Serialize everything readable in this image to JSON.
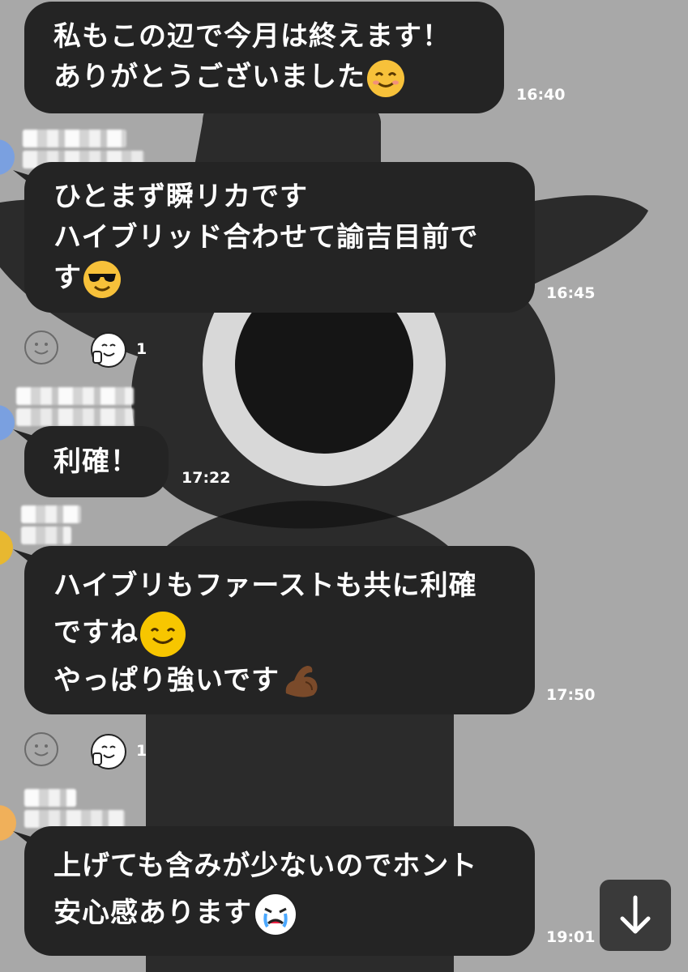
{
  "messages": [
    {
      "lines": [
        "私もこの辺で今月は終えます！",
        "ありがとうございました"
      ],
      "time": "16:40"
    },
    {
      "lines": [
        "ひとまず瞬リカです",
        "ハイブリッド合わせて諭吉目前で",
        "す"
      ],
      "time": "16:45",
      "reaction_count": "1"
    },
    {
      "lines": [
        "利確！"
      ],
      "time": "17:22"
    },
    {
      "lines": [
        "ハイブリもファーストも共に利確",
        "ですね",
        "やっぱり強いです"
      ],
      "time": "17:50",
      "reaction_count": "1"
    },
    {
      "lines": [
        "上げても含みが少ないのでホント",
        "安心感あります"
      ],
      "time": "19:01"
    }
  ],
  "icons": {
    "smile": "smiling-face-emoji",
    "sunglasses": "sunglasses-face-emoji",
    "flex": "flexed-biceps-emoji",
    "crying": "crying-face-emoji",
    "reaction": "thumbs-up-sticker",
    "add_reaction": "add-reaction-icon",
    "scroll": "arrow-down-icon"
  },
  "colors": {
    "background": "#a8a8a8",
    "bubble": "#242424",
    "text": "#ffffff"
  }
}
